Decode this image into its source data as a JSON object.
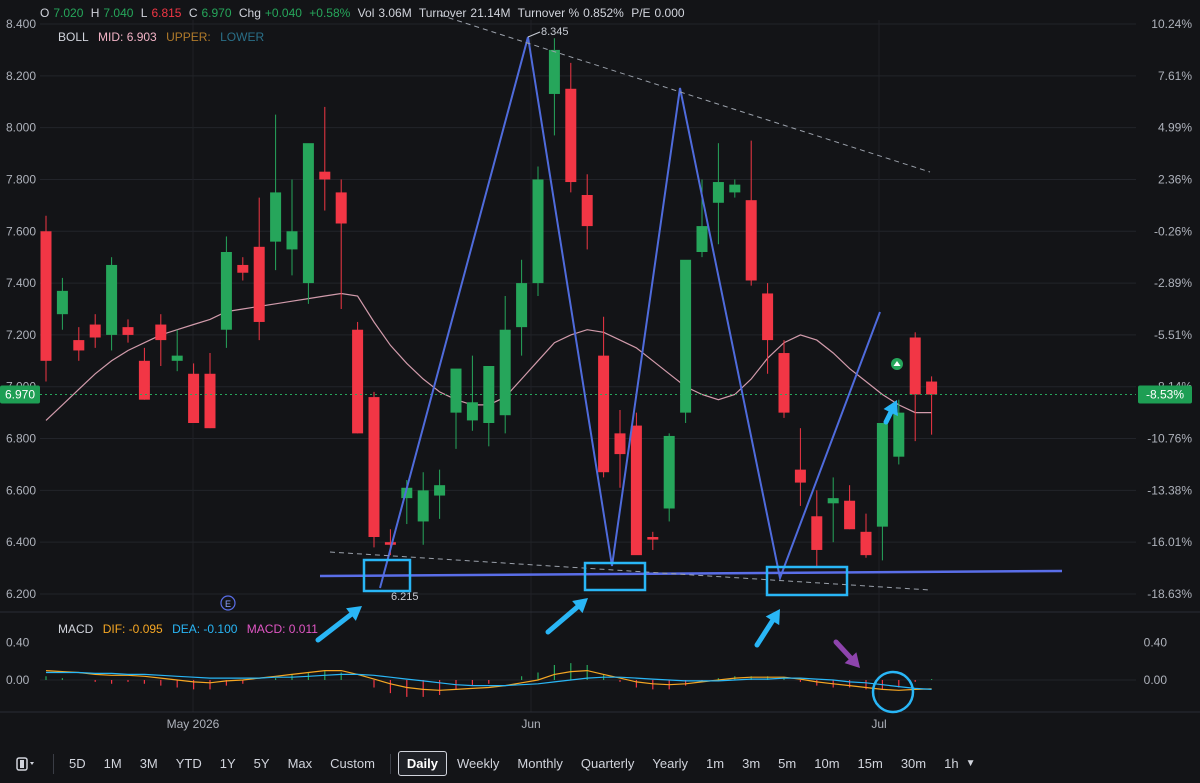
{
  "header": {
    "o_label": "O",
    "o_val": "7.020",
    "h_label": "H",
    "h_val": "7.040",
    "l_label": "L",
    "l_val": "6.815",
    "c_label": "C",
    "c_val": "6.970",
    "chg_label": "Chg",
    "chg_val": "+0.040",
    "pct_val": "+0.58%",
    "vol_label": "Vol",
    "vol_val": "3.06M",
    "turnover_label": "Turnover",
    "turnover_val": "21.14M",
    "turnover_pct_label": "Turnover %",
    "turnover_pct_val": "0.852%",
    "pe_label": "P/E",
    "pe_val": "0.000"
  },
  "boll": {
    "name": "BOLL",
    "mid": "MID: 6.903",
    "upper": "UPPER:",
    "lower": "LOWER"
  },
  "macd_header": {
    "name": "MACD",
    "dif": "DIF: -0.095",
    "dea": "DEA: -0.100",
    "macd": "MACD: 0.011"
  },
  "price_badge": "6.970",
  "pct_badge": "-8.53%",
  "earnings_marker": "E",
  "annotations": {
    "high": "8.345",
    "low": "6.215"
  },
  "colors": {
    "up": "#26a65b",
    "down": "#f23645",
    "background": "#131417",
    "trendline": "#4f6bdc",
    "box": "#29b6f6",
    "mid_band": "#f3b3c6",
    "dif": "#f5a623",
    "dea": "#29b6f6",
    "arrow_blue": "#29b6f6",
    "arrow_purple": "#8e44ad"
  },
  "toolbar": {
    "layout_icon": "candle-layout-icon",
    "items": [
      "5D",
      "1M",
      "3M",
      "YTD",
      "1Y",
      "5Y",
      "Max",
      "Custom"
    ],
    "periods": [
      "Daily",
      "Weekly",
      "Monthly",
      "Quarterly",
      "Yearly",
      "1m",
      "3m",
      "5m",
      "10m",
      "15m",
      "30m",
      "1h"
    ],
    "active": "Daily"
  },
  "chart_data": {
    "type": "candlestick",
    "y_axis_left": {
      "ticks": [
        "8.400",
        "8.200",
        "8.000",
        "7.800",
        "7.600",
        "7.400",
        "7.200",
        "7.000",
        "6.800",
        "6.600",
        "6.400",
        "6.200"
      ],
      "range": [
        6.15,
        8.42
      ]
    },
    "y_axis_right": {
      "ticks": [
        "10.24%",
        "7.61%",
        "4.99%",
        "2.36%",
        "-0.26%",
        "-2.89%",
        "-5.51%",
        "-8.14%",
        "-10.76%",
        "-13.38%",
        "-16.01%",
        "-18.63%"
      ]
    },
    "x_labels": [
      "May 2026",
      "Jun",
      "Jul"
    ],
    "candles": [
      {
        "o": 7.6,
        "h": 7.66,
        "l": 7.02,
        "c": 7.1
      },
      {
        "o": 7.28,
        "h": 7.42,
        "l": 7.22,
        "c": 7.37
      },
      {
        "o": 7.18,
        "h": 7.23,
        "l": 7.1,
        "c": 7.14
      },
      {
        "o": 7.24,
        "h": 7.28,
        "l": 7.15,
        "c": 7.19
      },
      {
        "o": 7.2,
        "h": 7.5,
        "l": 7.14,
        "c": 7.47
      },
      {
        "o": 7.23,
        "h": 7.26,
        "l": 7.17,
        "c": 7.2
      },
      {
        "o": 7.1,
        "h": 7.15,
        "l": 6.95,
        "c": 6.95
      },
      {
        "o": 7.24,
        "h": 7.28,
        "l": 7.08,
        "c": 7.18
      },
      {
        "o": 7.1,
        "h": 7.22,
        "l": 7.06,
        "c": 7.12
      },
      {
        "o": 7.05,
        "h": 7.09,
        "l": 6.86,
        "c": 6.86
      },
      {
        "o": 7.05,
        "h": 7.13,
        "l": 6.84,
        "c": 6.84
      },
      {
        "o": 7.22,
        "h": 7.58,
        "l": 7.15,
        "c": 7.52
      },
      {
        "o": 7.47,
        "h": 7.5,
        "l": 7.41,
        "c": 7.44
      },
      {
        "o": 7.54,
        "h": 7.73,
        "l": 7.18,
        "c": 7.25
      },
      {
        "o": 7.56,
        "h": 8.05,
        "l": 7.45,
        "c": 7.75
      },
      {
        "o": 7.53,
        "h": 7.8,
        "l": 7.43,
        "c": 7.6
      },
      {
        "o": 7.4,
        "h": 7.82,
        "l": 7.32,
        "c": 7.94
      },
      {
        "o": 7.83,
        "h": 8.08,
        "l": 7.68,
        "c": 7.8
      },
      {
        "o": 7.75,
        "h": 7.8,
        "l": 7.3,
        "c": 7.63
      },
      {
        "o": 7.22,
        "h": 7.25,
        "l": 6.82,
        "c": 6.82
      },
      {
        "o": 6.96,
        "h": 6.98,
        "l": 6.38,
        "c": 6.42
      },
      {
        "o": 6.4,
        "h": 6.45,
        "l": 6.35,
        "c": 6.39
      },
      {
        "o": 6.57,
        "h": 6.64,
        "l": 6.47,
        "c": 6.61
      },
      {
        "o": 6.48,
        "h": 6.67,
        "l": 6.39,
        "c": 6.6
      },
      {
        "o": 6.58,
        "h": 6.68,
        "l": 6.49,
        "c": 6.62
      },
      {
        "o": 6.9,
        "h": 6.98,
        "l": 6.76,
        "c": 7.07
      },
      {
        "o": 6.87,
        "h": 7.12,
        "l": 6.83,
        "c": 6.94
      },
      {
        "o": 6.86,
        "h": 6.92,
        "l": 6.77,
        "c": 7.08
      },
      {
        "o": 6.89,
        "h": 7.35,
        "l": 6.82,
        "c": 7.22
      },
      {
        "o": 7.23,
        "h": 7.49,
        "l": 7.12,
        "c": 7.4
      },
      {
        "o": 7.4,
        "h": 7.85,
        "l": 7.35,
        "c": 7.8
      },
      {
        "o": 8.13,
        "h": 8.345,
        "l": 7.97,
        "c": 8.3
      },
      {
        "o": 8.15,
        "h": 8.25,
        "l": 7.75,
        "c": 7.79
      },
      {
        "o": 7.74,
        "h": 7.82,
        "l": 7.53,
        "c": 7.62
      },
      {
        "o": 7.12,
        "h": 7.27,
        "l": 6.65,
        "c": 6.67
      },
      {
        "o": 6.82,
        "h": 6.91,
        "l": 6.61,
        "c": 6.74
      },
      {
        "o": 6.85,
        "h": 6.9,
        "l": 6.41,
        "c": 6.35
      },
      {
        "o": 6.42,
        "h": 6.44,
        "l": 6.37,
        "c": 6.41
      },
      {
        "o": 6.53,
        "h": 6.82,
        "l": 6.48,
        "c": 6.81
      },
      {
        "o": 6.9,
        "h": 7.15,
        "l": 6.86,
        "c": 7.49
      },
      {
        "o": 7.52,
        "h": 7.8,
        "l": 7.5,
        "c": 7.62
      },
      {
        "o": 7.71,
        "h": 7.94,
        "l": 7.55,
        "c": 7.79
      },
      {
        "o": 7.75,
        "h": 7.8,
        "l": 7.73,
        "c": 7.78
      },
      {
        "o": 7.72,
        "h": 7.95,
        "l": 7.39,
        "c": 7.41
      },
      {
        "o": 7.36,
        "h": 7.4,
        "l": 7.05,
        "c": 7.18
      },
      {
        "o": 7.13,
        "h": 7.18,
        "l": 6.88,
        "c": 6.9
      },
      {
        "o": 6.68,
        "h": 6.84,
        "l": 6.54,
        "c": 6.63
      },
      {
        "o": 6.5,
        "h": 6.6,
        "l": 6.3,
        "c": 6.37
      },
      {
        "o": 6.55,
        "h": 6.65,
        "l": 6.4,
        "c": 6.57
      },
      {
        "o": 6.56,
        "h": 6.62,
        "l": 6.45,
        "c": 6.45
      },
      {
        "o": 6.44,
        "h": 6.51,
        "l": 6.34,
        "c": 6.35
      },
      {
        "o": 6.46,
        "h": 6.85,
        "l": 6.33,
        "c": 6.86
      },
      {
        "o": 6.73,
        "h": 6.95,
        "l": 6.7,
        "c": 6.9
      },
      {
        "o": 7.19,
        "h": 7.21,
        "l": 6.79,
        "c": 6.97
      },
      {
        "o": 7.02,
        "h": 7.04,
        "l": 6.815,
        "c": 6.97
      }
    ],
    "mid_band": [
      6.87,
      6.93,
      6.99,
      7.05,
      7.1,
      7.14,
      7.17,
      7.2,
      7.22,
      7.24,
      7.26,
      7.29,
      7.3,
      7.31,
      7.32,
      7.33,
      7.34,
      7.35,
      7.36,
      7.35,
      7.25,
      7.16,
      7.09,
      7.03,
      6.98,
      6.95,
      6.93,
      6.93,
      6.96,
      7.03,
      7.1,
      7.17,
      7.2,
      7.22,
      7.21,
      7.18,
      7.15,
      7.1,
      7.05,
      7.0,
      6.97,
      6.95,
      6.97,
      7.03,
      7.11,
      7.17,
      7.2,
      7.18,
      7.13,
      7.07,
      7.02,
      6.97,
      6.93,
      6.9,
      6.9
    ],
    "macd": {
      "range": [
        -0.16,
        0.44
      ],
      "ticks": [
        "0.40",
        "0.00"
      ],
      "dif": [
        0.1,
        0.09,
        0.08,
        0.06,
        0.05,
        0.05,
        0.04,
        0.02,
        0.0,
        -0.02,
        -0.03,
        -0.01,
        0.0,
        0.02,
        0.04,
        0.06,
        0.08,
        0.1,
        0.1,
        0.06,
        0.01,
        -0.04,
        -0.08,
        -0.1,
        -0.11,
        -0.1,
        -0.09,
        -0.08,
        -0.06,
        -0.03,
        0.0,
        0.06,
        0.09,
        0.1,
        0.06,
        0.02,
        -0.02,
        -0.04,
        -0.05,
        -0.04,
        -0.02,
        0.0,
        0.02,
        0.03,
        0.03,
        0.03,
        0.01,
        -0.02,
        -0.04,
        -0.06,
        -0.08,
        -0.1,
        -0.11,
        -0.1,
        -0.095
      ],
      "dea": [
        0.08,
        0.08,
        0.08,
        0.07,
        0.07,
        0.06,
        0.06,
        0.05,
        0.04,
        0.03,
        0.02,
        0.02,
        0.02,
        0.02,
        0.03,
        0.03,
        0.04,
        0.05,
        0.06,
        0.06,
        0.05,
        0.03,
        0.01,
        -0.01,
        -0.03,
        -0.05,
        -0.06,
        -0.06,
        -0.06,
        -0.05,
        -0.04,
        -0.02,
        0.0,
        0.02,
        0.03,
        0.03,
        0.02,
        0.01,
        0.0,
        -0.01,
        -0.01,
        -0.01,
        0.0,
        0.01,
        0.01,
        0.02,
        0.02,
        0.01,
        0.0,
        -0.02,
        -0.03,
        -0.05,
        -0.07,
        -0.09,
        -0.1
      ],
      "hist": [
        0.04,
        0.02,
        0.0,
        -0.02,
        -0.04,
        -0.02,
        -0.04,
        -0.06,
        -0.08,
        -0.1,
        -0.1,
        -0.06,
        -0.04,
        0.0,
        0.02,
        0.06,
        0.08,
        0.1,
        0.08,
        0.0,
        -0.08,
        -0.14,
        -0.18,
        -0.18,
        -0.16,
        -0.1,
        -0.06,
        -0.04,
        0.0,
        0.04,
        0.08,
        0.16,
        0.18,
        0.16,
        0.06,
        -0.02,
        -0.08,
        -0.1,
        -0.1,
        -0.06,
        -0.02,
        0.02,
        0.04,
        0.04,
        0.04,
        0.02,
        -0.02,
        -0.06,
        -0.08,
        -0.08,
        -0.1,
        -0.1,
        -0.08,
        -0.02,
        0.01
      ]
    }
  }
}
